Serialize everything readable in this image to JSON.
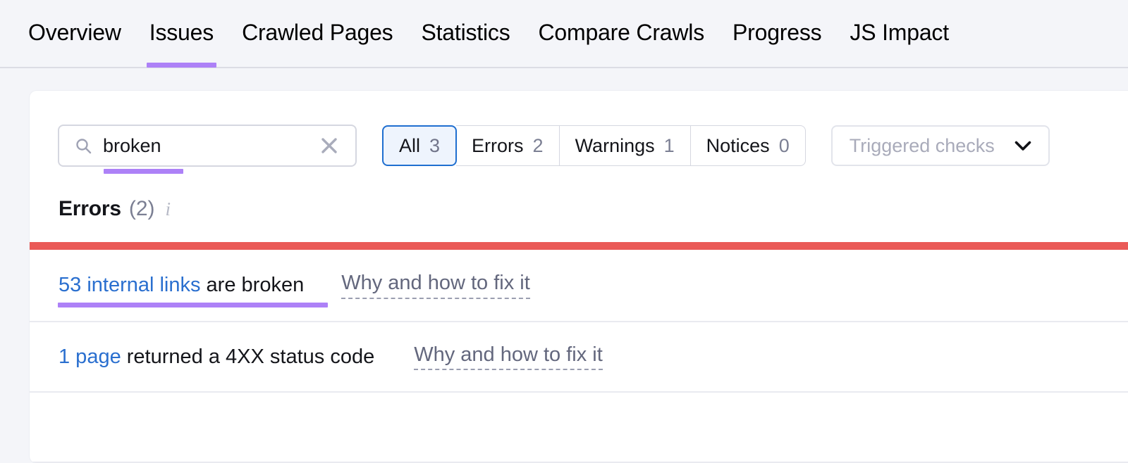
{
  "nav": {
    "tabs": [
      {
        "label": "Overview",
        "active": false
      },
      {
        "label": "Issues",
        "active": true
      },
      {
        "label": "Crawled Pages",
        "active": false
      },
      {
        "label": "Statistics",
        "active": false
      },
      {
        "label": "Compare Crawls",
        "active": false
      },
      {
        "label": "Progress",
        "active": false
      },
      {
        "label": "JS Impact",
        "active": false
      }
    ]
  },
  "toolbar": {
    "search": {
      "value": "broken",
      "placeholder": "Search",
      "icon": "search-icon",
      "clear_icon": "close-icon"
    },
    "segments": [
      {
        "label": "All",
        "count": "3",
        "selected": true
      },
      {
        "label": "Errors",
        "count": "2",
        "selected": false
      },
      {
        "label": "Warnings",
        "count": "1",
        "selected": false
      },
      {
        "label": "Notices",
        "count": "0",
        "selected": false
      }
    ],
    "dropdown": {
      "label": "Triggered checks",
      "icon": "chevron-down-icon"
    }
  },
  "section": {
    "title": "Errors",
    "count": "(2)",
    "info_icon": "i",
    "severity_color": "#ea5a57"
  },
  "issues": [
    {
      "link_text": "53 internal links",
      "rest_text": " are broken",
      "fix_label": "Why and how to fix it"
    },
    {
      "link_text": "1 page",
      "rest_text": " returned a 4XX status code",
      "fix_label": "Why and how to fix it"
    }
  ],
  "colors": {
    "accent_purple": "#ad81f7",
    "link_blue": "#2a6fcf",
    "selected_blue": "#1f6fd0",
    "error_red": "#ea5a57",
    "page_bg": "#f4f5f9"
  }
}
